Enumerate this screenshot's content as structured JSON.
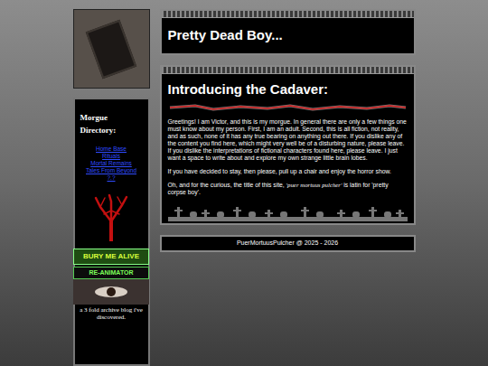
{
  "header": {
    "title": "Pretty Dead Boy..."
  },
  "sidebar": {
    "heading": "Morgue Directory:",
    "links": [
      "Home Base",
      "Rituals",
      "Mortal Remains",
      "Tales From Beyond",
      "?.?"
    ],
    "badges": [
      "BURY ME ALIVE",
      "RE-ANIMATOR"
    ],
    "caption": "a 3 fold archive blog i've discovered."
  },
  "intro": {
    "title": "Introducing the Cadaver:",
    "paragraphs": [
      "Greetings! I am Victor, and this is my morgue. In general there are only a few things one must know about my person. First, I am an adult. Second, this is all fiction, not reality, and as such, none of it has any true bearing on anything out there. If you dislike any of the content you find here, which might very well be of a disturbing nature, please leave. If you dislike the interpretations of fictional characters found here, please leave. I just want a space to write about and explore my own strange little brain lobes.",
      "If you have decided to stay, then please, pull up a chair and enjoy the horror show."
    ],
    "latin_note": {
      "before": "Oh, and for the curious, the title of this site, ",
      "italic": "'puer mortuus pulcher'",
      "after": " is latin for 'pretty corpse boy'."
    }
  },
  "footer": "PuerMortuusPulcher @ 2025 - 2026"
}
